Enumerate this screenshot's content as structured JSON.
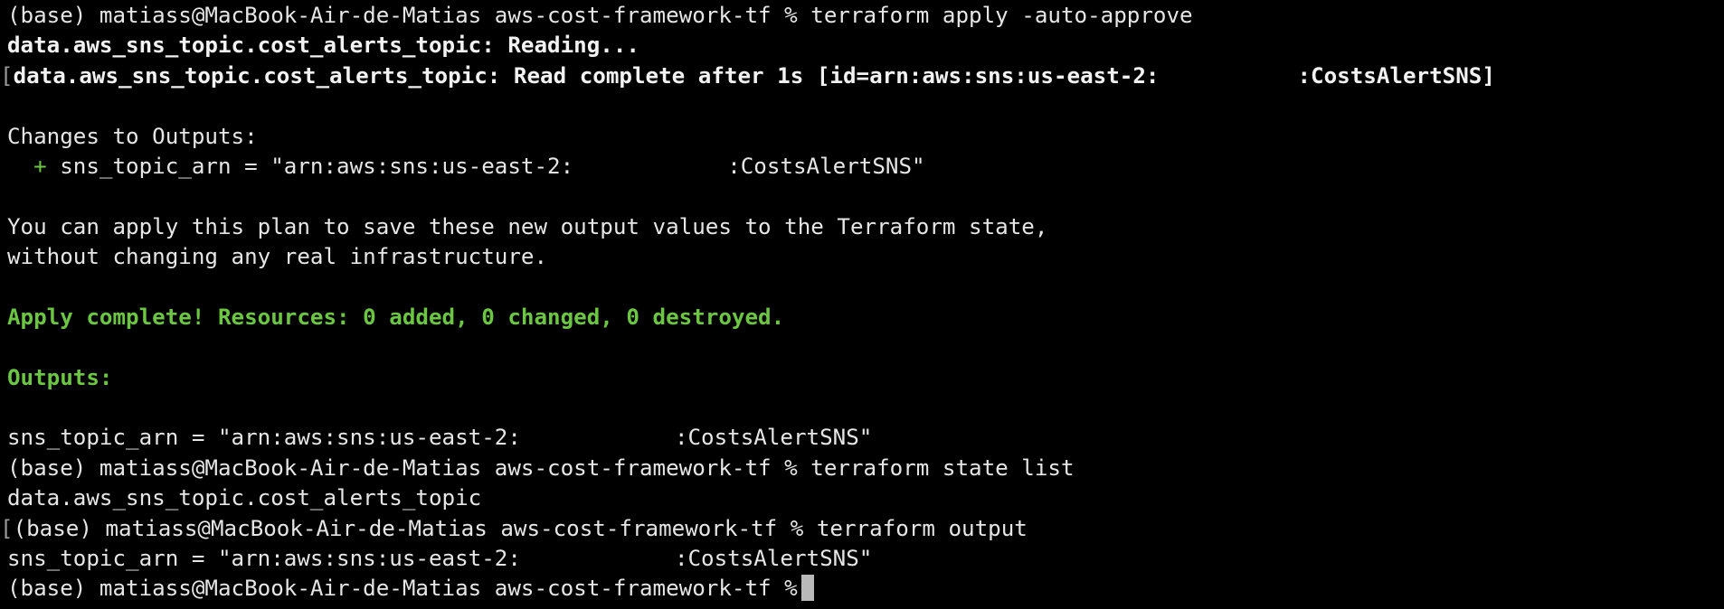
{
  "window": {
    "type": "terminal",
    "background": "#000000",
    "foreground": "#e6e6e6",
    "accent_green": "#6cc644"
  },
  "terminal": {
    "prompt": "(base) matiass@MacBook-Air-de-Matias aws-cost-framework-tf %",
    "cmd1": "terraform apply -auto-approve",
    "line2": "data.aws_sns_topic.cost_alerts_topic: Reading...",
    "line3_marker": "[",
    "line3_a": "data.aws_sns_topic.cost_alerts_topic: Read complete after 1s [id=arn:aws:sns:us-east-2:",
    "line3_b": ":CostsAlertSNS]",
    "changes_header": "Changes to Outputs:",
    "change_plus": "+",
    "change_a": "sns_topic_arn = \"arn:aws:sns:us-east-2:",
    "change_b": ":CostsAlertSNS\"",
    "apply_note_1": "You can apply this plan to save these new output values to the Terraform state,",
    "apply_note_2": "without changing any real infrastructure.",
    "apply_complete": "Apply complete! Resources: 0 added, 0 changed, 0 destroyed.",
    "outputs_header": "Outputs:",
    "output_a": "sns_topic_arn = \"arn:aws:sns:us-east-2:",
    "output_b": ":CostsAlertSNS\"",
    "cmd2": "terraform state list",
    "state_item": "data.aws_sns_topic.cost_alerts_topic",
    "line_marker": "[",
    "cmd3": "terraform output",
    "output2_a": "sns_topic_arn = \"arn:aws:sns:us-east-2:",
    "output2_b": ":CostsAlertSNS\""
  }
}
